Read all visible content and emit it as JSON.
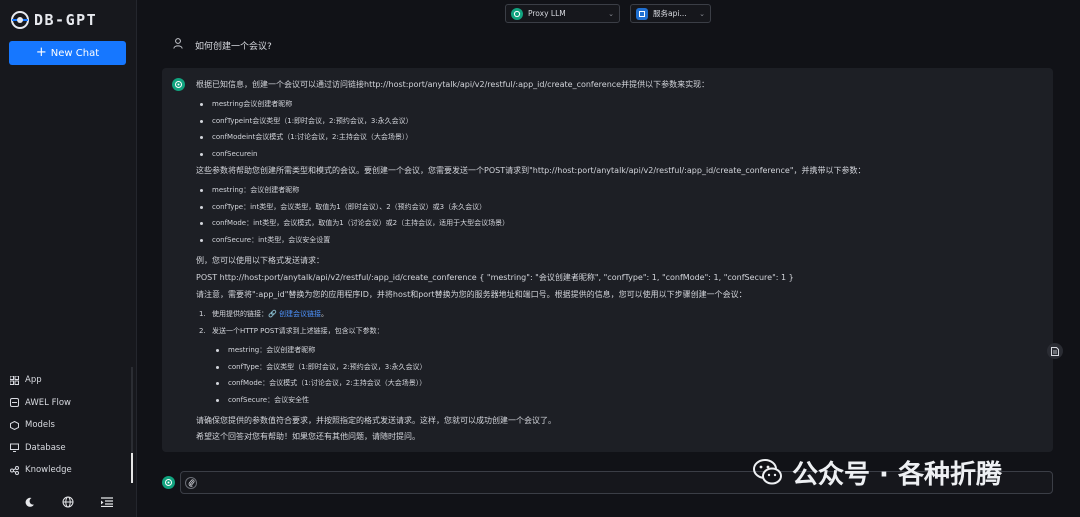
{
  "brand": {
    "name": "DB-GPT"
  },
  "sidebar": {
    "new_chat_label": "New Chat",
    "items": [
      {
        "label": "App",
        "icon": "app-grid-icon"
      },
      {
        "label": "AWEL Flow",
        "icon": "flow-icon"
      },
      {
        "label": "Models",
        "icon": "models-icon"
      },
      {
        "label": "Database",
        "icon": "database-icon"
      },
      {
        "label": "Knowledge",
        "icon": "knowledge-icon"
      }
    ],
    "bottom_icons": [
      "moon-icon",
      "globe-icon",
      "collapse-menu-icon"
    ]
  },
  "header": {
    "model_select": {
      "value": "Proxy LLM"
    },
    "app_select": {
      "value": "服务api..."
    }
  },
  "question": {
    "text": "如何创建一个会议?"
  },
  "answer": {
    "intro": "根据已知信息，创建一个会议可以通过访问链接http://host:port/anytalk/api/v2/restful/:app_id/create_conference并提供以下参数来实现：",
    "params1": [
      "mestring会议创建者昵称",
      "confTypeint会议类型（1:即时会议，2:预约会议，3:永久会议）",
      "confModeint会议模式（1:讨论会议，2:主持会议（大会场景））",
      "confSecurein"
    ],
    "para2": "这些参数将帮助您创建所需类型和模式的会议。要创建一个会议，您需要发送一个POST请求到\"http://host:port/anytalk/api/v2/restful/:app_id/create_conference\"，并携带以下参数：",
    "params2": [
      "mestring：会议创建者昵称",
      "confType：int类型，会议类型，取值为1（即时会议）、2（预约会议）或3（永久会议）",
      "confMode：int类型，会议模式，取值为1（讨论会议）或2（主持会议，适用于大型会议场景）",
      "confSecure：int类型，会议安全设置"
    ],
    "para3": "例，您可以使用以下格式发送请求：",
    "para4": "POST http://host:port/anytalk/api/v2/restful/:app_id/create_conference { \"mestring\": \"会议创建者昵称\", \"confType\": 1, \"confMode\": 1, \"confSecure\": 1 }",
    "para5": "请注意，需要将\":app_id\"替换为您的应用程序ID，并将host和port替换为您的服务器地址和端口号。根据提供的信息，您可以使用以下步骤创建一个会议：",
    "step1_prefix": "使用提供的链接：",
    "step1_link": "创建会议链接",
    "step1_suffix": "。",
    "step2": "发送一个HTTP POST请求到上述链接，包含以下参数：",
    "params3": [
      "mestring：会议创建者昵称",
      "confType：会议类型（1:即时会议，2:预约会议，3:永久会议）",
      "confMode：会议模式（1:讨论会议，2:主持会议（大会场景））",
      "confSecure：会议安全性"
    ],
    "para6": "请确保您提供的参数值符合要求，并按照指定的格式发送请求。这样，您就可以成功创建一个会议了。",
    "para7": "希望这个回答对您有帮助！如果您还有其他问题，请随时提问。"
  },
  "input": {
    "placeholder": ""
  },
  "watermark": {
    "text": "公众号 · 各种折腾"
  },
  "colors": {
    "accent": "#1677ff",
    "ai_avatar": "#11a37f",
    "background": "#111217",
    "card": "#1d1f25"
  }
}
